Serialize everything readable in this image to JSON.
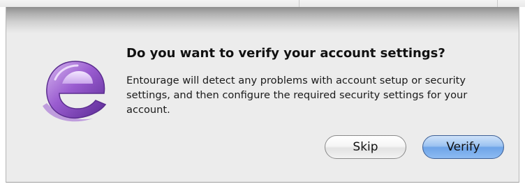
{
  "dialog": {
    "heading": "Do you want to verify your account settings?",
    "message": "Entourage will detect any problems with account setup or security settings, and then configure the required security settings for your account.",
    "app_icon": "entourage-e-icon"
  },
  "buttons": {
    "skip_label": "Skip",
    "verify_label": "Verify"
  },
  "colors": {
    "sheet_background": "#ececec",
    "default_button": "#7fb0ec",
    "icon_purple": "#8a4fc0"
  }
}
